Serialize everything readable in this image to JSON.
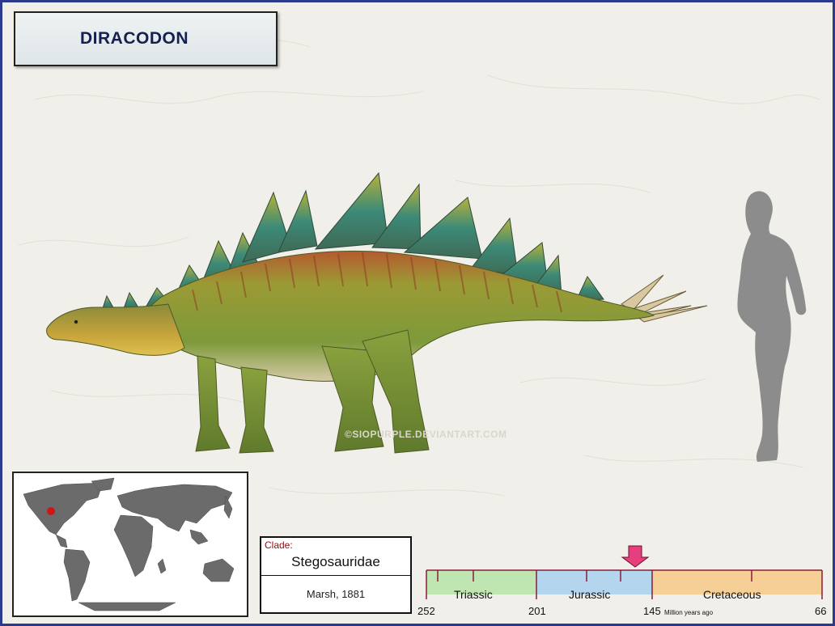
{
  "title": "DIRACODON",
  "watermark": "©SIOPURPLE.DEVIANTART.COM",
  "clade": {
    "label": "Clade:",
    "name": "Stegosauridae",
    "author": "Marsh, 1881"
  },
  "map": {
    "marker_color": "#d01515"
  },
  "timeline": {
    "periods": [
      {
        "name": "Triassic",
        "color": "#bfe6b0"
      },
      {
        "name": "Jurassic",
        "color": "#b3d6ee"
      },
      {
        "name": "Cretaceous",
        "color": "#f5cf96"
      }
    ],
    "boundaries": [
      "252",
      "201",
      "145",
      "66"
    ],
    "unit": "Million years ago",
    "axis_color": "#8a1c3a",
    "arrow_color": "#e63f7e"
  }
}
